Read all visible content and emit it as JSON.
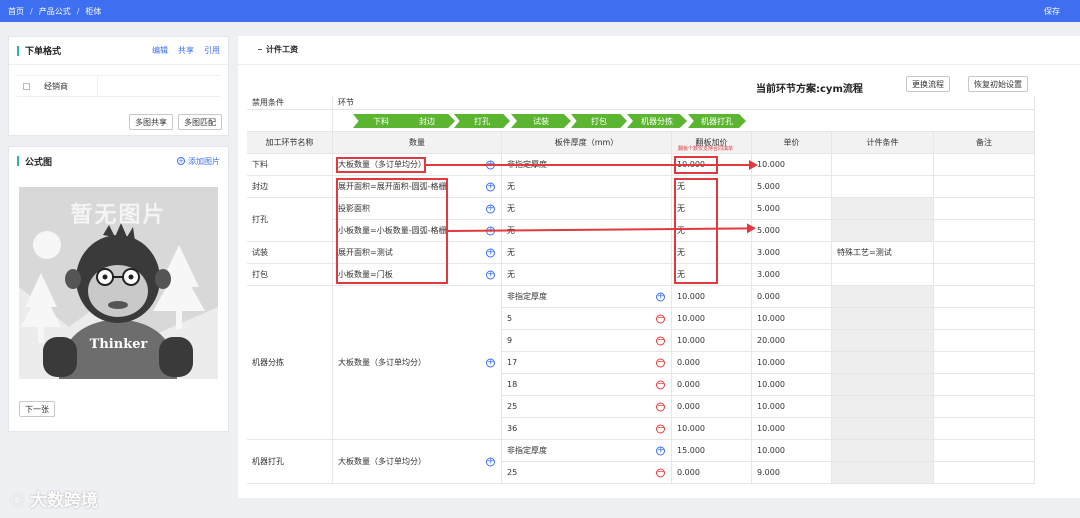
{
  "breadcrumb": [
    "首页",
    "产品公式",
    "柜体"
  ],
  "topbar": {
    "save_label": "保存"
  },
  "order_card": {
    "title": "下单格式",
    "links": {
      "edit": "编辑",
      "share": "共享",
      "reference": "引用"
    },
    "row_label": "经销商",
    "buttons": {
      "multi_share": "多图共享",
      "multi_match": "多图匹配"
    }
  },
  "formula_card": {
    "title": "公式图",
    "add_image": "添加图片",
    "no_image_text": "暂无图片",
    "mascot_text": "Thinker",
    "next_button": "下一张"
  },
  "main": {
    "section_title": "计件工资",
    "plan_label": "当前环节方案:cym流程",
    "switch_flow": "更换流程",
    "restore_default": "恢复初始设置",
    "disabled_condition": "禁用条件",
    "stage_header": "环节",
    "stages": [
      "下料",
      "封边",
      "打孔",
      "试装",
      "打包",
      "机器分拣",
      "机器打孔"
    ],
    "columns": {
      "process": "加工环节名称",
      "quantity": "数量",
      "thickness": "板件厚度（mm）",
      "flip_price": "翻板加价",
      "flip_note": "翻板个数仅支持合同填单",
      "unit_price": "单价",
      "piece_condition": "计件条件",
      "remark": "备注"
    },
    "rows": [
      {
        "process": "下料",
        "quantity": "大板数量（多订单均分）",
        "thickness": "非指定厚度",
        "flip": "10.000",
        "price": "10.000",
        "condition": "",
        "remark": ""
      },
      {
        "process": "封边",
        "quantity": "展开面积=展开面积-圆弧-格栅",
        "thickness": "无",
        "flip": "无",
        "price": "5.000",
        "condition": "",
        "remark": ""
      },
      {
        "process": "打孔",
        "quantity": "投影面积",
        "thickness": "无",
        "flip": "无",
        "price": "5.000",
        "condition": "",
        "remark": ""
      },
      {
        "process": "",
        "quantity": "小板数量=小板数量-圆弧-格栅",
        "thickness": "无",
        "flip": "无",
        "price": "5.000",
        "condition": "",
        "remark": ""
      },
      {
        "process": "试装",
        "quantity": "展开面积=测试",
        "thickness": "无",
        "flip": "无",
        "price": "3.000",
        "condition": "特殊工艺=测试",
        "remark": ""
      },
      {
        "process": "打包",
        "quantity": "小板数量=门板",
        "thickness": "无",
        "flip": "无",
        "price": "3.000",
        "condition": "",
        "remark": ""
      }
    ],
    "sorting": {
      "process": "机器分拣",
      "quantity": "大板数量（多订单均分）",
      "items": [
        {
          "thickness": "非指定厚度",
          "flip": "10.000",
          "price": "0.000"
        },
        {
          "thickness": "5",
          "flip": "10.000",
          "price": "10.000"
        },
        {
          "thickness": "9",
          "flip": "10.000",
          "price": "20.000"
        },
        {
          "thickness": "17",
          "flip": "0.000",
          "price": "10.000"
        },
        {
          "thickness": "18",
          "flip": "0.000",
          "price": "10.000"
        },
        {
          "thickness": "25",
          "flip": "0.000",
          "price": "10.000"
        },
        {
          "thickness": "36",
          "flip": "10.000",
          "price": "10.000"
        }
      ]
    },
    "drilling": {
      "process": "机器打孔",
      "quantity": "大板数量（多订单均分）",
      "items": [
        {
          "thickness": "非指定厚度",
          "flip": "15.000",
          "price": "10.000"
        },
        {
          "thickness": "25",
          "flip": "0.000",
          "price": "9.000"
        }
      ]
    }
  },
  "watermark": "大数跨境",
  "colors": {
    "topbar": "#3d6ff0",
    "stage": "#5cb531",
    "annotation": "#e0393e",
    "accent_bar": "#2ab7a9"
  }
}
